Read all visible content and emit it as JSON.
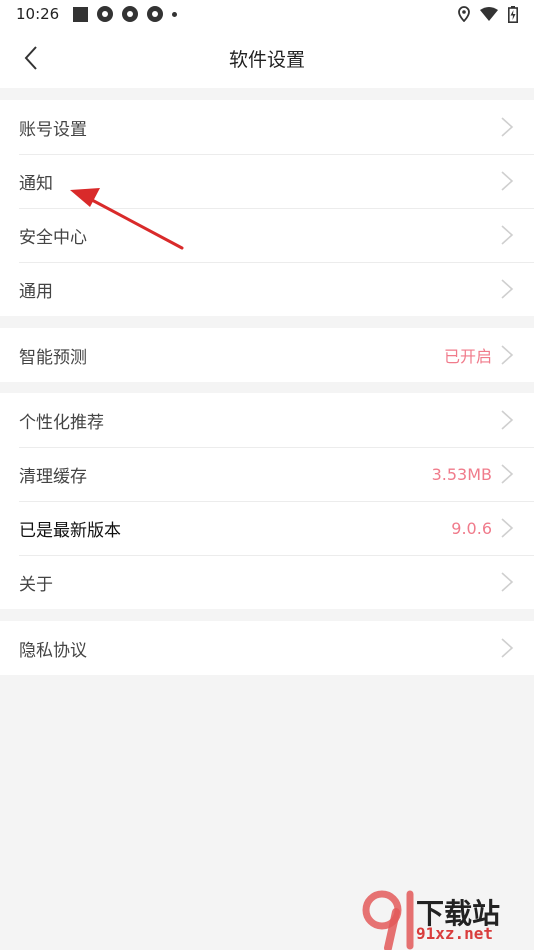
{
  "status_bar": {
    "time": "10:26"
  },
  "header": {
    "title": "软件设置"
  },
  "groups": [
    {
      "items": [
        {
          "label": "账号设置"
        },
        {
          "label": "通知"
        },
        {
          "label": "安全中心"
        },
        {
          "label": "通用"
        }
      ]
    },
    {
      "items": [
        {
          "label": "智能预测",
          "value": "已开启"
        }
      ]
    },
    {
      "items": [
        {
          "label": "个性化推荐"
        },
        {
          "label": "清理缓存",
          "value": "3.53MB"
        },
        {
          "label": "已是最新版本",
          "value": "9.0.6"
        },
        {
          "label": "关于"
        }
      ]
    },
    {
      "items": [
        {
          "label": "隐私协议"
        }
      ]
    }
  ],
  "watermark": {
    "text": "下载站",
    "url": "91xz.net"
  },
  "colors": {
    "accent": "#f07b8b",
    "arrow": "#d92a2a",
    "background": "#f4f4f4"
  }
}
